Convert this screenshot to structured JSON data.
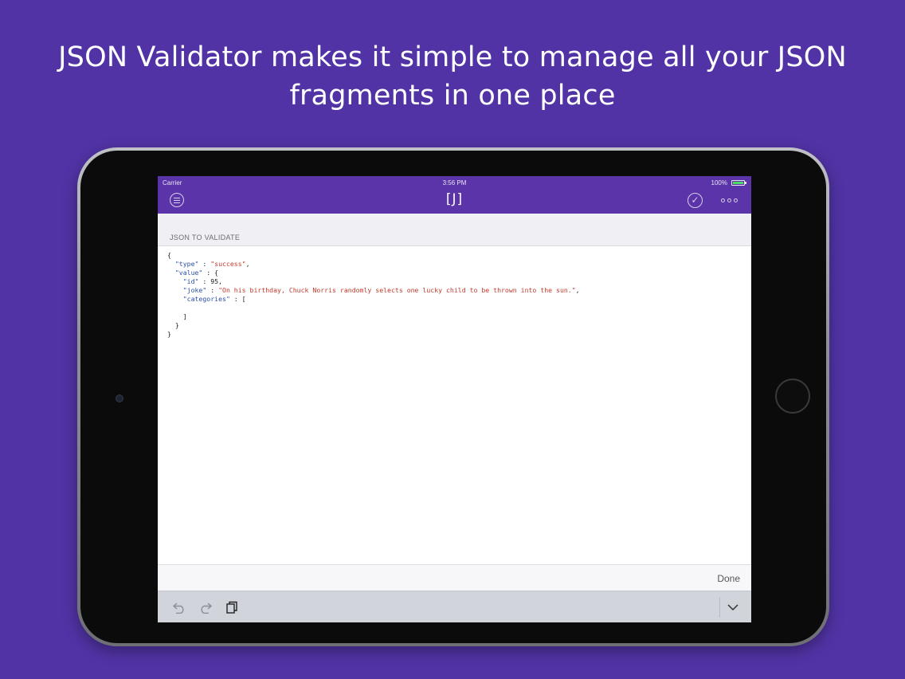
{
  "headline": {
    "line1": "JSON Validator makes it simple to manage all your JSON",
    "line2": "fragments in one place"
  },
  "status_bar": {
    "carrier": "Carrier",
    "time": "3:56 PM",
    "battery": "100%"
  },
  "navbar": {
    "title": "[J]",
    "icons": [
      "menu-icon",
      "checkmark-icon",
      "more-icon"
    ]
  },
  "section": {
    "label": "JSON TO VALIDATE"
  },
  "editor": {
    "lines": [
      {
        "indent": "",
        "key": "",
        "sep": "",
        "value": "",
        "punct": "{"
      },
      {
        "indent": "  ",
        "key": "\"type\"",
        "sep": " : ",
        "value": "\"success\"",
        "punct": ","
      },
      {
        "indent": "  ",
        "key": "\"value\"",
        "sep": " : ",
        "value": "",
        "punct": "{"
      },
      {
        "indent": "    ",
        "key": "\"id\"",
        "sep": " : ",
        "value": "",
        "punct": "95,"
      },
      {
        "indent": "    ",
        "key": "\"joke\"",
        "sep": " : ",
        "value": "\"On his birthday, Chuck Norris randomly selects one lucky child to be thrown into the sun.\"",
        "punct": ","
      },
      {
        "indent": "    ",
        "key": "\"categories\"",
        "sep": " : ",
        "value": "",
        "punct": "["
      },
      {
        "indent": "",
        "key": "",
        "sep": "",
        "value": "",
        "punct": ""
      },
      {
        "indent": "    ",
        "key": "",
        "sep": "",
        "value": "",
        "punct": "]"
      },
      {
        "indent": "  ",
        "key": "",
        "sep": "",
        "value": "",
        "punct": "}"
      },
      {
        "indent": "",
        "key": "",
        "sep": "",
        "value": "",
        "punct": "}"
      }
    ]
  },
  "keyboard_bar": {
    "done_label": "Done",
    "icons": [
      "undo-icon",
      "redo-icon",
      "paste-icon",
      "dismiss-keyboard-icon"
    ]
  },
  "colors": {
    "background": "#5133a5",
    "navbar": "#5a34a8",
    "json_key": "#2a4fa8",
    "json_string": "#c0392b"
  }
}
